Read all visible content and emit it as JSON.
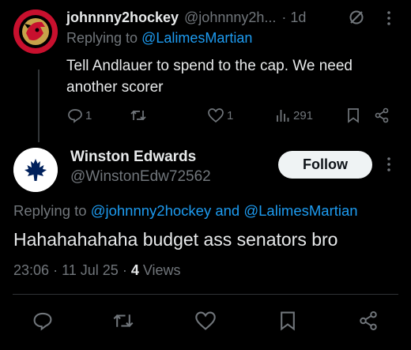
{
  "reply1": {
    "display_name": "johnnny2hockey",
    "handle": "@johnnny2h...",
    "time": "· 1d",
    "replying_prefix": "Replying to",
    "replying_to": "@LalimesMartian",
    "text_line1": "Tell Andlauer to spend to the cap. We need",
    "text_line2": "another scorer",
    "actions": {
      "replies": "1",
      "retweets": "",
      "likes": "1",
      "views": "291"
    }
  },
  "main": {
    "display_name": "Winston Edwards",
    "handle": "@WinstonEdw72562",
    "follow_label": "Follow",
    "replying_prefix": "Replying to",
    "replying_user1": "@johnnny2hockey",
    "replying_and": "and",
    "replying_user2": "@LalimesMartian",
    "text": "Hahahahahaha budget ass senators bro",
    "time": "23:06",
    "date": "11 Jul 25",
    "views_count": "4",
    "views_label": "Views"
  },
  "icons": {
    "more": "more-icon",
    "grok": "grok-icon",
    "reply": "reply-icon",
    "retweet": "retweet-icon",
    "like": "like-icon",
    "views": "views-icon",
    "bookmark": "bookmark-icon",
    "share": "share-icon"
  },
  "colors": {
    "background": "#000000",
    "text": "#e7e9ea",
    "muted": "#71767b",
    "link": "#1d9bf0",
    "senators_red": "#c8102e",
    "leafs_blue": "#00205b"
  }
}
